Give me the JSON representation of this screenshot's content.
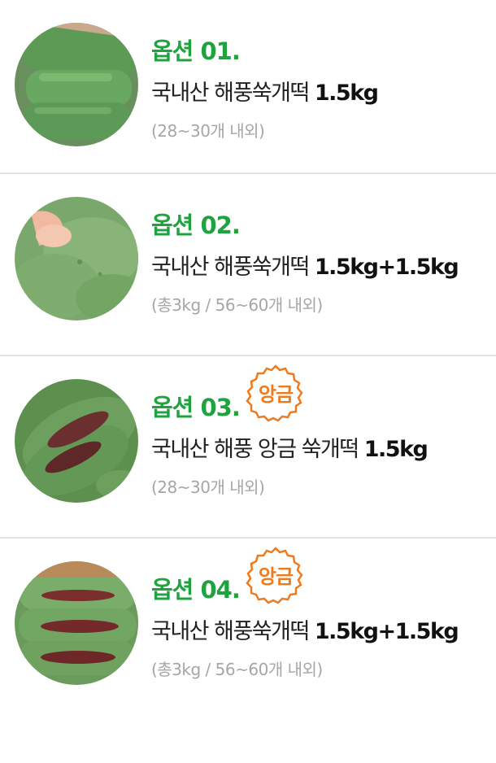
{
  "options": [
    {
      "title": "옵션 01.",
      "name": "국내산 해풍쑥개떡 ",
      "weight": "1.5kg",
      "note": "(28~30개 내외)",
      "badge": ""
    },
    {
      "title": "옵션 02.",
      "name": "국내산 해풍쑥개떡 ",
      "weight": "1.5kg+1.5kg",
      "note": "(총3kg / 56~60개 내외)",
      "badge": ""
    },
    {
      "title": "옵션 03.",
      "name": "국내산 해풍 앙금 쑥개떡 ",
      "weight": "1.5kg",
      "note": "(28~30개 내외)",
      "badge": "앙금"
    },
    {
      "title": "옵션 04.",
      "name": "국내산 해풍쑥개떡 ",
      "weight": "1.5kg+1.5kg",
      "note": "(총3kg / 56~60개 내외)",
      "badge": "앙금"
    }
  ],
  "colors": {
    "title_green": "#1fa23f",
    "badge_orange": "#ef7a1e",
    "note_gray": "#a6a6a6",
    "rice_cake_green": "#5f9a58"
  },
  "icons": {
    "badge": "scalloped-seal-icon"
  }
}
